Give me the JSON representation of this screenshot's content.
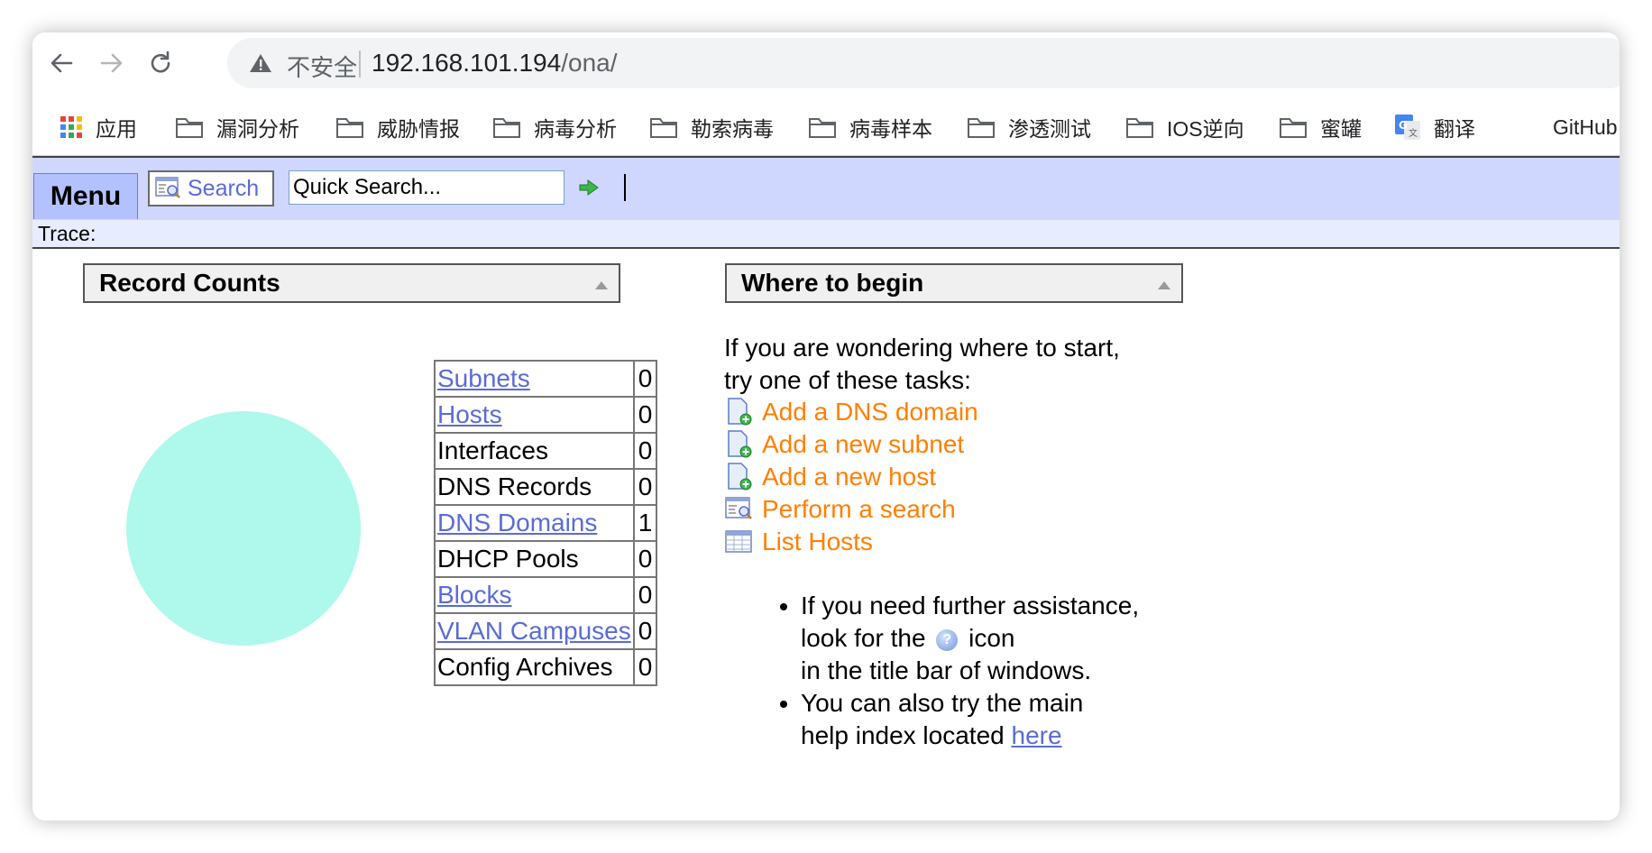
{
  "browser": {
    "security_label": "不安全",
    "url_host": "192.168.101.194",
    "url_path": "/ona/"
  },
  "bookmarks": [
    {
      "label": "应用",
      "icon": "apps-grid-icon"
    },
    {
      "label": "漏洞分析",
      "icon": "folder-icon"
    },
    {
      "label": "威胁情报",
      "icon": "folder-icon"
    },
    {
      "label": "病毒分析",
      "icon": "folder-icon"
    },
    {
      "label": "勒索病毒",
      "icon": "folder-icon"
    },
    {
      "label": "病毒样本",
      "icon": "folder-icon"
    },
    {
      "label": "渗透测试",
      "icon": "folder-icon"
    },
    {
      "label": "IOS逆向",
      "icon": "folder-icon"
    },
    {
      "label": "蜜罐",
      "icon": "folder-icon"
    },
    {
      "label": "翻译",
      "icon": "google-translate-icon"
    },
    {
      "label": "GitHub",
      "icon": ""
    }
  ],
  "appbar": {
    "menu_label": "Menu",
    "search_label": "Search",
    "quick_search_value": "Quick Search...",
    "trace_label": "Trace:"
  },
  "record_counts": {
    "title": "Record Counts",
    "rows": [
      {
        "label": "Subnets",
        "count": "0",
        "link": true
      },
      {
        "label": "Hosts",
        "count": "0",
        "link": true
      },
      {
        "label": "Interfaces",
        "count": "0",
        "link": false
      },
      {
        "label": "DNS Records",
        "count": "0",
        "link": false
      },
      {
        "label": "DNS Domains",
        "count": "1",
        "link": true
      },
      {
        "label": "DHCP Pools",
        "count": "0",
        "link": false
      },
      {
        "label": "Blocks",
        "count": "0",
        "link": true
      },
      {
        "label": "VLAN Campuses",
        "count": "0",
        "link": true
      },
      {
        "label": "Config Archives",
        "count": "0",
        "link": false
      }
    ],
    "pie_color": "#aef8ec"
  },
  "where_to_begin": {
    "title": "Where to begin",
    "intro_line1": "If you are wondering where to start,",
    "intro_line2": "try one of these tasks:",
    "tasks": [
      {
        "label": "Add a DNS domain",
        "icon": "add-document-icon"
      },
      {
        "label": "Add a new subnet",
        "icon": "add-document-icon"
      },
      {
        "label": "Add a new host",
        "icon": "add-document-icon"
      },
      {
        "label": "Perform a search",
        "icon": "search-window-icon"
      },
      {
        "label": "List Hosts",
        "icon": "table-list-icon"
      }
    ],
    "help1_line1": "If you need further assistance,",
    "help1_line2a": "look for the",
    "help1_line2b": "icon",
    "help1_line3": "in the title bar of windows.",
    "help2_line1": "You can also try the main",
    "help2_line2": "help index located",
    "help2_link": "here"
  },
  "colors": {
    "appbar_bg": "#cfd7ff",
    "menu_tab_bg": "#b3c2ff",
    "link": "#5a6bd6",
    "task_link": "#ff7f00"
  }
}
